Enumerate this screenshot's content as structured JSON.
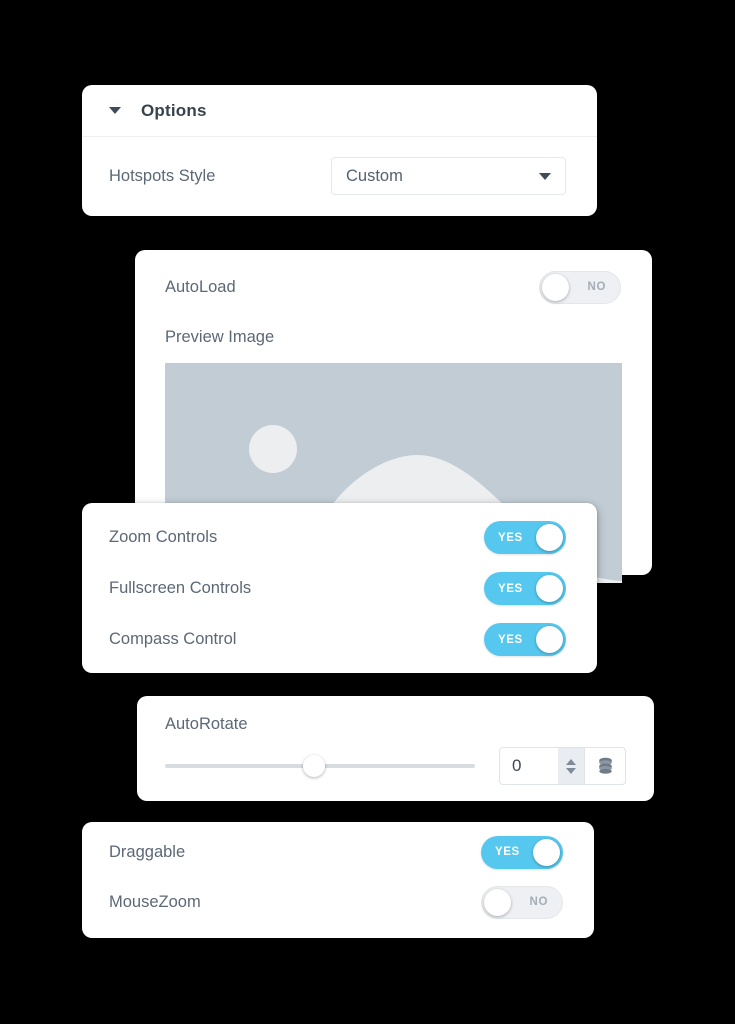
{
  "theme": {
    "background": "#000000",
    "card_background": "#ffffff",
    "toggle_on_color": "#56c8ef",
    "toggle_off_color": "#eef0f3",
    "label_color": "#5c6876",
    "preview_sky_color": "#c2ccd4",
    "preview_shape_color": "#eceef0"
  },
  "options_panel": {
    "title": "Options",
    "collapse_icon": "caret-down-icon",
    "hotspots_style": {
      "label": "Hotspots Style",
      "value": "Custom",
      "caret_icon": "caret-down-icon"
    }
  },
  "preview_panel": {
    "autoload": {
      "label": "AutoLoad",
      "state": "NO"
    },
    "preview_image": {
      "label": "Preview Image",
      "placeholder_icon": "image-placeholder-icon"
    }
  },
  "controls_panel": {
    "rows": [
      {
        "label": "Zoom Controls",
        "state": "YES"
      },
      {
        "label": "Fullscreen Controls",
        "state": "YES"
      },
      {
        "label": "Compass Control",
        "state": "YES"
      }
    ]
  },
  "autorotate_panel": {
    "label": "AutoRotate",
    "slider_value_percent": 48,
    "number_value": "0",
    "stepper_up_icon": "chevron-up-icon",
    "stepper_down_icon": "chevron-down-icon",
    "database_icon": "database-icon"
  },
  "drag_panel": {
    "rows": [
      {
        "label": "Draggable",
        "state": "YES"
      },
      {
        "label": "MouseZoom",
        "state": "NO"
      }
    ]
  }
}
